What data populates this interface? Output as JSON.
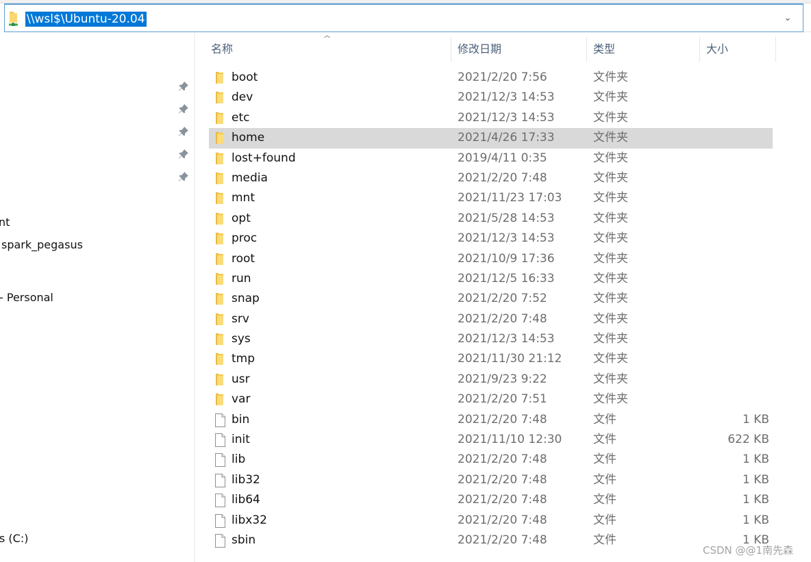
{
  "address_bar": {
    "path": "\\\\wsl$\\Ubuntu-20.04",
    "icon": "network-folder-icon",
    "dropdown_icon": "chevron-down-icon"
  },
  "sidebar": {
    "pinned_count": 5,
    "items": [
      {
        "label": "nt"
      },
      {
        "label": "spark_pegasus"
      },
      {
        "label": "- Personal"
      },
      {
        "label": "s (C:)"
      }
    ]
  },
  "columns": {
    "name": "名称",
    "date": "修改日期",
    "type": "类型",
    "size": "大小",
    "sort_indicator": "^"
  },
  "files": [
    {
      "name": "boot",
      "date": "2021/2/20 7:56",
      "type": "文件夹",
      "size": "",
      "kind": "folder"
    },
    {
      "name": "dev",
      "date": "2021/12/3 14:53",
      "type": "文件夹",
      "size": "",
      "kind": "folder"
    },
    {
      "name": "etc",
      "date": "2021/12/3 14:53",
      "type": "文件夹",
      "size": "",
      "kind": "folder"
    },
    {
      "name": "home",
      "date": "2021/4/26 17:33",
      "type": "文件夹",
      "size": "",
      "kind": "folder",
      "selected": true
    },
    {
      "name": "lost+found",
      "date": "2019/4/11 0:35",
      "type": "文件夹",
      "size": "",
      "kind": "folder"
    },
    {
      "name": "media",
      "date": "2021/2/20 7:48",
      "type": "文件夹",
      "size": "",
      "kind": "folder"
    },
    {
      "name": "mnt",
      "date": "2021/11/23 17:03",
      "type": "文件夹",
      "size": "",
      "kind": "folder"
    },
    {
      "name": "opt",
      "date": "2021/5/28 14:53",
      "type": "文件夹",
      "size": "",
      "kind": "folder"
    },
    {
      "name": "proc",
      "date": "2021/12/3 14:53",
      "type": "文件夹",
      "size": "",
      "kind": "folder"
    },
    {
      "name": "root",
      "date": "2021/10/9 17:36",
      "type": "文件夹",
      "size": "",
      "kind": "folder"
    },
    {
      "name": "run",
      "date": "2021/12/5 16:33",
      "type": "文件夹",
      "size": "",
      "kind": "folder"
    },
    {
      "name": "snap",
      "date": "2021/2/20 7:52",
      "type": "文件夹",
      "size": "",
      "kind": "folder"
    },
    {
      "name": "srv",
      "date": "2021/2/20 7:48",
      "type": "文件夹",
      "size": "",
      "kind": "folder"
    },
    {
      "name": "sys",
      "date": "2021/12/3 14:53",
      "type": "文件夹",
      "size": "",
      "kind": "folder"
    },
    {
      "name": "tmp",
      "date": "2021/11/30 21:12",
      "type": "文件夹",
      "size": "",
      "kind": "folder"
    },
    {
      "name": "usr",
      "date": "2021/9/23 9:22",
      "type": "文件夹",
      "size": "",
      "kind": "folder"
    },
    {
      "name": "var",
      "date": "2021/2/20 7:51",
      "type": "文件夹",
      "size": "",
      "kind": "folder"
    },
    {
      "name": "bin",
      "date": "2021/2/20 7:48",
      "type": "文件",
      "size": "1 KB",
      "kind": "file"
    },
    {
      "name": "init",
      "date": "2021/11/10 12:30",
      "type": "文件",
      "size": "622 KB",
      "kind": "file"
    },
    {
      "name": "lib",
      "date": "2021/2/20 7:48",
      "type": "文件",
      "size": "1 KB",
      "kind": "file"
    },
    {
      "name": "lib32",
      "date": "2021/2/20 7:48",
      "type": "文件",
      "size": "1 KB",
      "kind": "file"
    },
    {
      "name": "lib64",
      "date": "2021/2/20 7:48",
      "type": "文件",
      "size": "1 KB",
      "kind": "file"
    },
    {
      "name": "libx32",
      "date": "2021/2/20 7:48",
      "type": "文件",
      "size": "1 KB",
      "kind": "file"
    },
    {
      "name": "sbin",
      "date": "2021/2/20 7:48",
      "type": "文件",
      "size": "1 KB",
      "kind": "file"
    }
  ],
  "watermark": "CSDN @@1南先森",
  "colors": {
    "selection_bg": "#d9d9d9",
    "address_highlight": "#0078d7",
    "address_border": "#5a9fd6",
    "folder_yellow": "#f5c84c",
    "header_text": "#4c607a",
    "secondary_text": "#6d6d6d"
  }
}
